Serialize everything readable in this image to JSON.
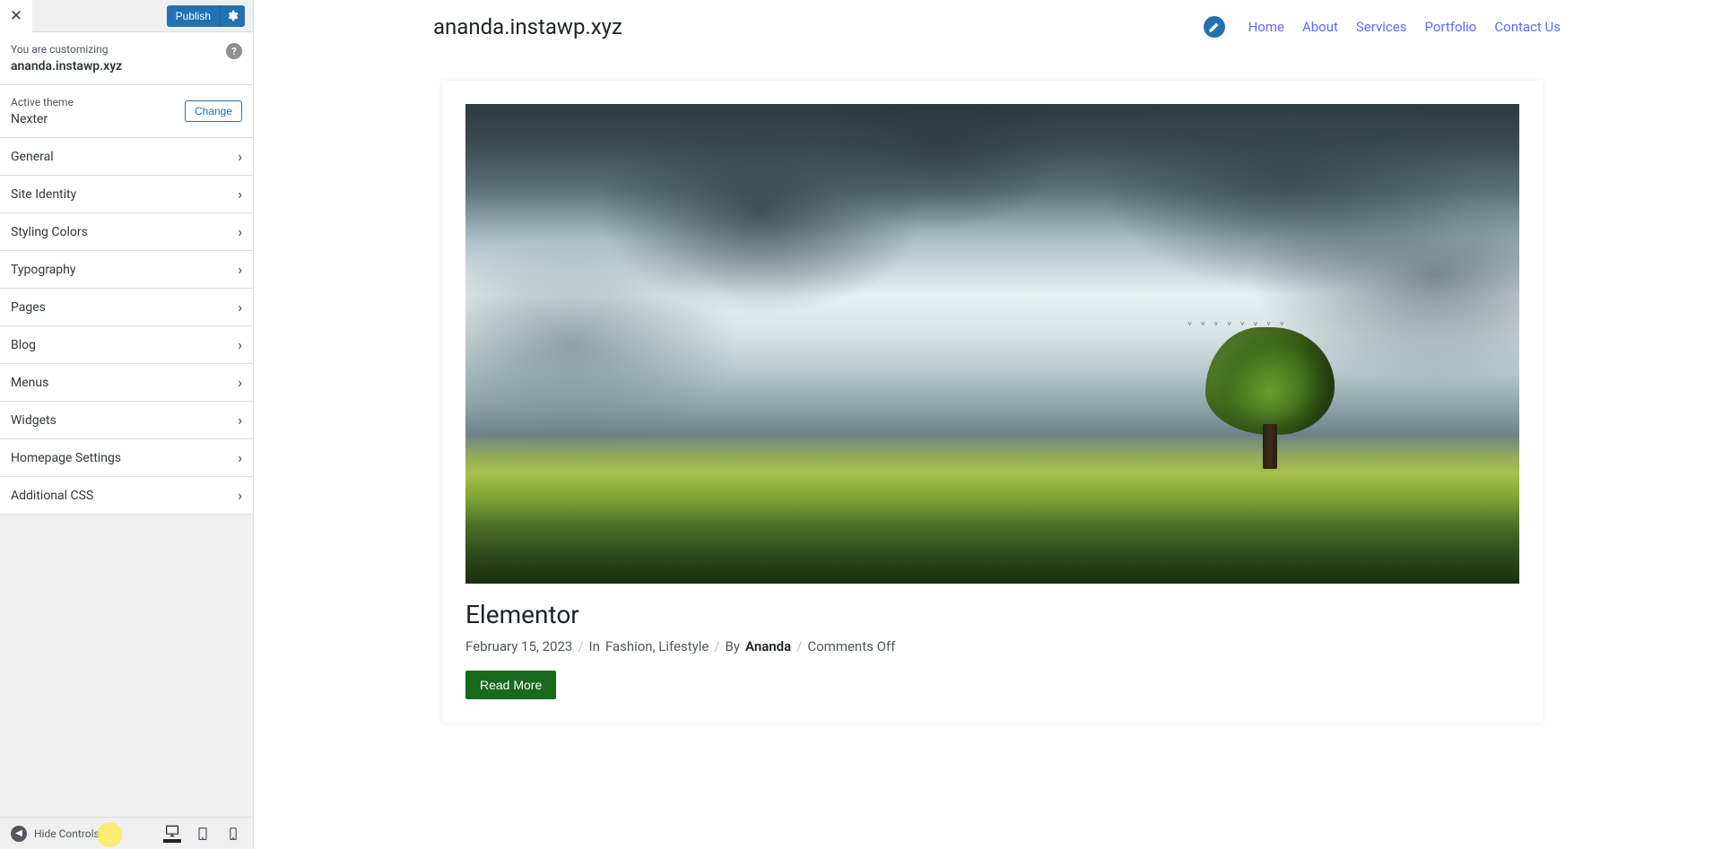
{
  "header": {
    "publish_label": "Publish"
  },
  "customizing": {
    "label": "You are customizing",
    "site": "ananda.instawp.xyz"
  },
  "theme": {
    "label": "Active theme",
    "name": "Nexter",
    "change_label": "Change"
  },
  "menu": [
    "General",
    "Site Identity",
    "Styling Colors",
    "Typography",
    "Pages",
    "Blog",
    "Menus",
    "Widgets",
    "Homepage Settings",
    "Additional CSS"
  ],
  "footer": {
    "hide_label": "Hide Controls"
  },
  "preview": {
    "site_title": "ananda.instawp.xyz",
    "nav": [
      "Home",
      "About",
      "Services",
      "Portfolio",
      "Contact Us"
    ],
    "post": {
      "title": "Elementor",
      "date": "February 15, 2023",
      "in_label": "In",
      "categories": "Fashion, Lifestyle",
      "by_label": "By",
      "author": "Ananda",
      "comments": "Comments Off",
      "read_more": "Read More"
    }
  }
}
